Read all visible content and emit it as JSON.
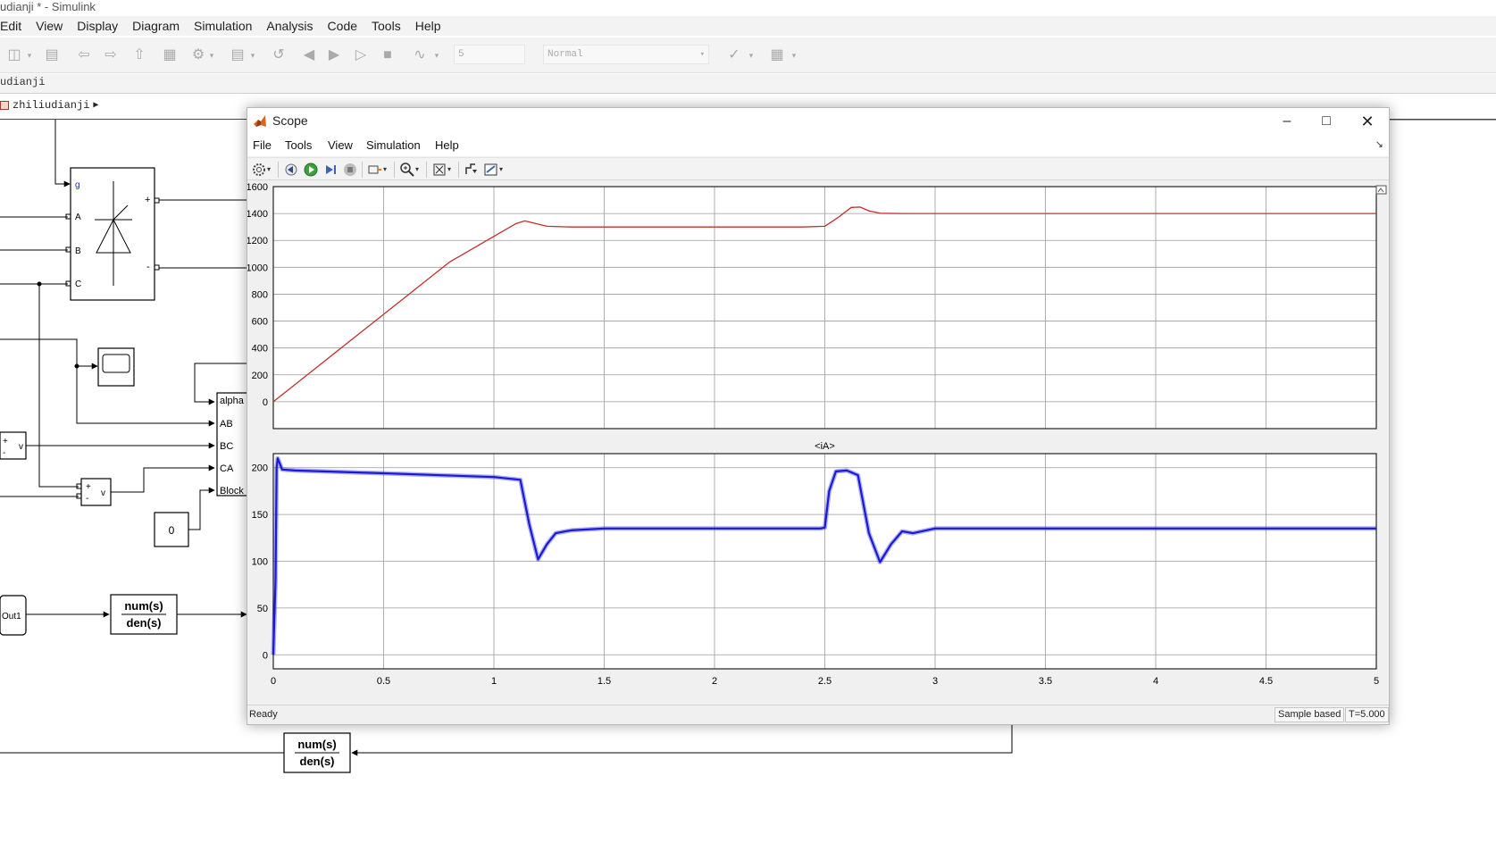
{
  "simulink": {
    "window_title": "udianji * - Simulink",
    "menu": [
      "Edit",
      "View",
      "Display",
      "Diagram",
      "Simulation",
      "Analysis",
      "Code",
      "Tools",
      "Help"
    ],
    "stop_time": "5",
    "sim_mode": "Normal",
    "tab_label": "udianji",
    "breadcrumb": "zhiliudianji"
  },
  "diagram": {
    "thyristor_ports": [
      "g",
      "A",
      "B",
      "C"
    ],
    "thyristor_out_plus": "+",
    "thyristor_out_minus": "-",
    "pulse_ports": [
      "alpha",
      "AB",
      "BC",
      "CA",
      "Block"
    ],
    "voltmeter_plus": "+",
    "voltmeter_minus": "-",
    "voltmeter_label": "v",
    "constant_value": "0",
    "out_port": "Out1",
    "tf_num": "num(s)",
    "tf_den": "den(s)"
  },
  "scope": {
    "title": "Scope",
    "menu": [
      "File",
      "Tools",
      "View",
      "Simulation",
      "Help"
    ],
    "status": "Ready",
    "sample_mode": "Sample based",
    "time": "T=5.000",
    "colors": {
      "top_trace": "#c0302a",
      "bottom_trace": "#1a1ad6"
    }
  },
  "chart_data": [
    {
      "type": "line",
      "title": "",
      "xlim": [
        0,
        5
      ],
      "ylim": [
        -200,
        1600
      ],
      "yticks": [
        0,
        200,
        400,
        600,
        800,
        1000,
        1200,
        1400,
        1600
      ],
      "grid": true,
      "series": [
        {
          "color": "#c0302a",
          "x": [
            0,
            0.2,
            0.5,
            0.8,
            1.1,
            1.14,
            1.18,
            1.24,
            1.35,
            1.6,
            2.0,
            2.4,
            2.5,
            2.56,
            2.62,
            2.66,
            2.7,
            2.75,
            2.85,
            3.0,
            4.0,
            5.0
          ],
          "y": [
            0,
            260,
            650,
            1040,
            1325,
            1345,
            1330,
            1305,
            1300,
            1300,
            1300,
            1300,
            1305,
            1370,
            1445,
            1448,
            1420,
            1402,
            1400,
            1400,
            1400,
            1400
          ]
        }
      ]
    },
    {
      "type": "line",
      "title": "<iA>",
      "xlim": [
        0,
        5
      ],
      "ylim": [
        -15,
        215
      ],
      "xticks": [
        "0",
        "0.5",
        "1",
        "1.5",
        "2",
        "2.5",
        "3",
        "3.5",
        "4",
        "4.5",
        "5"
      ],
      "yticks": [
        0,
        50,
        100,
        150,
        200
      ],
      "grid": true,
      "series": [
        {
          "color": "#1a1ad6",
          "x": [
            0,
            0.01,
            0.015,
            0.02,
            0.04,
            0.1,
            0.5,
            1.0,
            1.12,
            1.16,
            1.2,
            1.24,
            1.28,
            1.35,
            1.5,
            2.0,
            2.48,
            2.5,
            2.52,
            2.55,
            2.6,
            2.65,
            2.7,
            2.75,
            2.8,
            2.85,
            2.9,
            3.0,
            4.0,
            5.0
          ],
          "y": [
            0,
            80,
            200,
            210,
            198,
            197,
            194,
            190,
            187,
            140,
            102,
            118,
            130,
            133,
            135,
            135,
            135,
            136,
            175,
            196,
            197,
            192,
            130,
            99,
            118,
            132,
            130,
            135,
            135,
            135
          ]
        }
      ]
    }
  ]
}
